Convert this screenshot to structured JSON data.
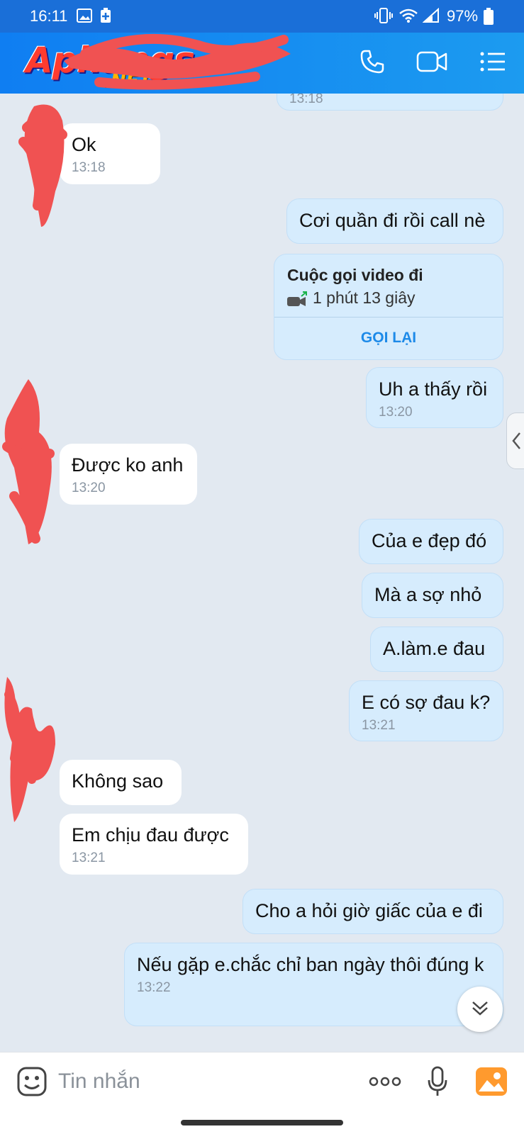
{
  "status": {
    "time": "16:11",
    "battery": "97%"
  },
  "header": {
    "logo_main": "Aphangs",
    "logo_sub": ".NET",
    "icons": [
      "back-icon",
      "phone-icon",
      "video-call-icon",
      "menu-icon"
    ]
  },
  "top_partial_time": "13:18",
  "messages": [
    {
      "id": "m1",
      "dir": "in",
      "text": "Ok",
      "time": "13:18"
    },
    {
      "id": "m2",
      "dir": "out",
      "text": "Cơi quần đi rồi call nè"
    },
    {
      "id": "m4",
      "dir": "out",
      "text": "Uh a thấy rồi",
      "time": "13:20"
    },
    {
      "id": "m5",
      "dir": "in",
      "text": "Được ko anh",
      "time": "13:20"
    },
    {
      "id": "m6",
      "dir": "out",
      "text": "Của e đẹp đó"
    },
    {
      "id": "m7",
      "dir": "out",
      "text": "Mà a sợ nhỏ"
    },
    {
      "id": "m8",
      "dir": "out",
      "text": "A.làm.e đau"
    },
    {
      "id": "m9",
      "dir": "out",
      "text": "E có sợ đau k?",
      "time": "13:21"
    },
    {
      "id": "m10",
      "dir": "in",
      "text": "Không sao"
    },
    {
      "id": "m11",
      "dir": "in",
      "text": "Em chịu đau được",
      "time": "13:21"
    },
    {
      "id": "m12",
      "dir": "out",
      "text": "Cho a hỏi giờ giấc của e đi"
    },
    {
      "id": "m13",
      "dir": "out",
      "text": "Nếu gặp e.chắc chỉ ban ngày thôi đúng k",
      "time": "13:22"
    }
  ],
  "call_card": {
    "title": "Cuộc gọi video đi",
    "duration": "1 phút 13 giây",
    "action": "GỌI LẠI"
  },
  "composer": {
    "placeholder": "Tin nhắn"
  },
  "colors": {
    "header": "#1c8cf0",
    "out_bubble": "#d6ecfd",
    "in_bubble": "#ffffff",
    "background": "#e2e9f1",
    "redact": "#f05252"
  }
}
